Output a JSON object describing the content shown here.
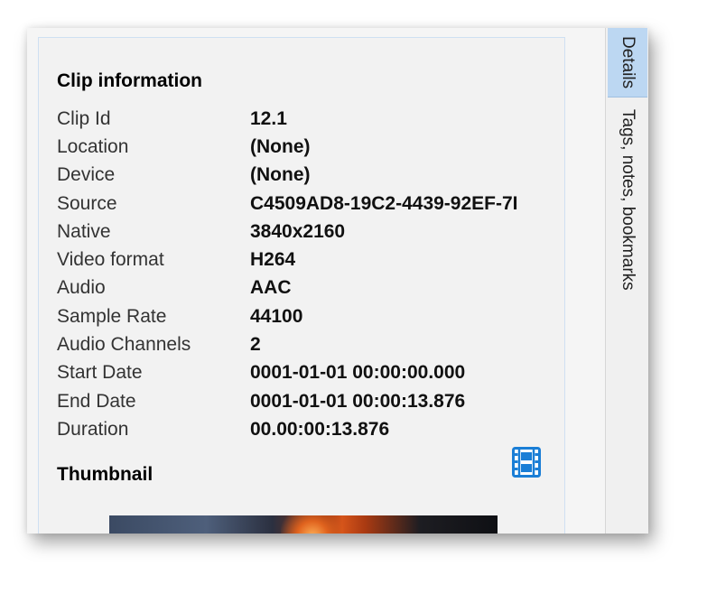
{
  "clip_info": {
    "title": "Clip information",
    "rows": [
      {
        "label": "Clip Id",
        "value": "12.1"
      },
      {
        "label": "Location",
        "value": "(None)"
      },
      {
        "label": "Device",
        "value": "(None)"
      },
      {
        "label": "Source",
        "value": "C4509AD8-19C2-4439-92EF-7I"
      },
      {
        "label": "Native",
        "value": "3840x2160"
      },
      {
        "label": "Video format",
        "value": "H264"
      },
      {
        "label": "Audio",
        "value": "AAC"
      },
      {
        "label": "Sample Rate",
        "value": "44100"
      },
      {
        "label": "Audio Channels",
        "value": "2"
      },
      {
        "label": "Start Date",
        "value": "0001-01-01 00:00:00.000"
      },
      {
        "label": "End Date",
        "value": "0001-01-01 00:00:13.876"
      },
      {
        "label": "Duration",
        "value": "00.00:00:13.876"
      }
    ]
  },
  "thumbnail": {
    "title": "Thumbnail",
    "icon": "film-icon"
  },
  "side_tabs": [
    {
      "label": "Details",
      "selected": true
    },
    {
      "label": "Tags, notes, bookmarks",
      "selected": false
    }
  ],
  "colors": {
    "accent": "#1a7ed6",
    "selected_tab": "#bcd7f2",
    "panel_border": "#cfe0f2"
  }
}
